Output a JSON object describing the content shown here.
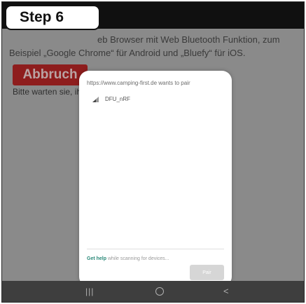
{
  "step_badge": {
    "label": "Step 6"
  },
  "webpage": {
    "intro_text": "eb Browser mit Web Bluetooth Funktion, zum Beispiel „Google Chrome“ für Android und „Bluefy“ für iOS.",
    "cancel_button": "Abbruch",
    "wait_text": "Bitte warten sie, ih"
  },
  "pair_dialog": {
    "title": "https://www.camping-first.de wants to pair",
    "devices": [
      {
        "name": "DFU_nRF",
        "icon": "signal-strength-icon"
      }
    ],
    "help_link": "Get help",
    "help_text": " while scanning for devices...",
    "pair_button": "Pair"
  },
  "navbar": {
    "recents_glyph": "|||",
    "back_glyph": "<"
  },
  "colors": {
    "backdrop": "#8a8a8a",
    "cancel_button_bg": "#8e1d1d",
    "help_link": "#2c8a7a",
    "pair_button_disabled": "#d6d6d6",
    "navbar": "#3e3e3e"
  }
}
